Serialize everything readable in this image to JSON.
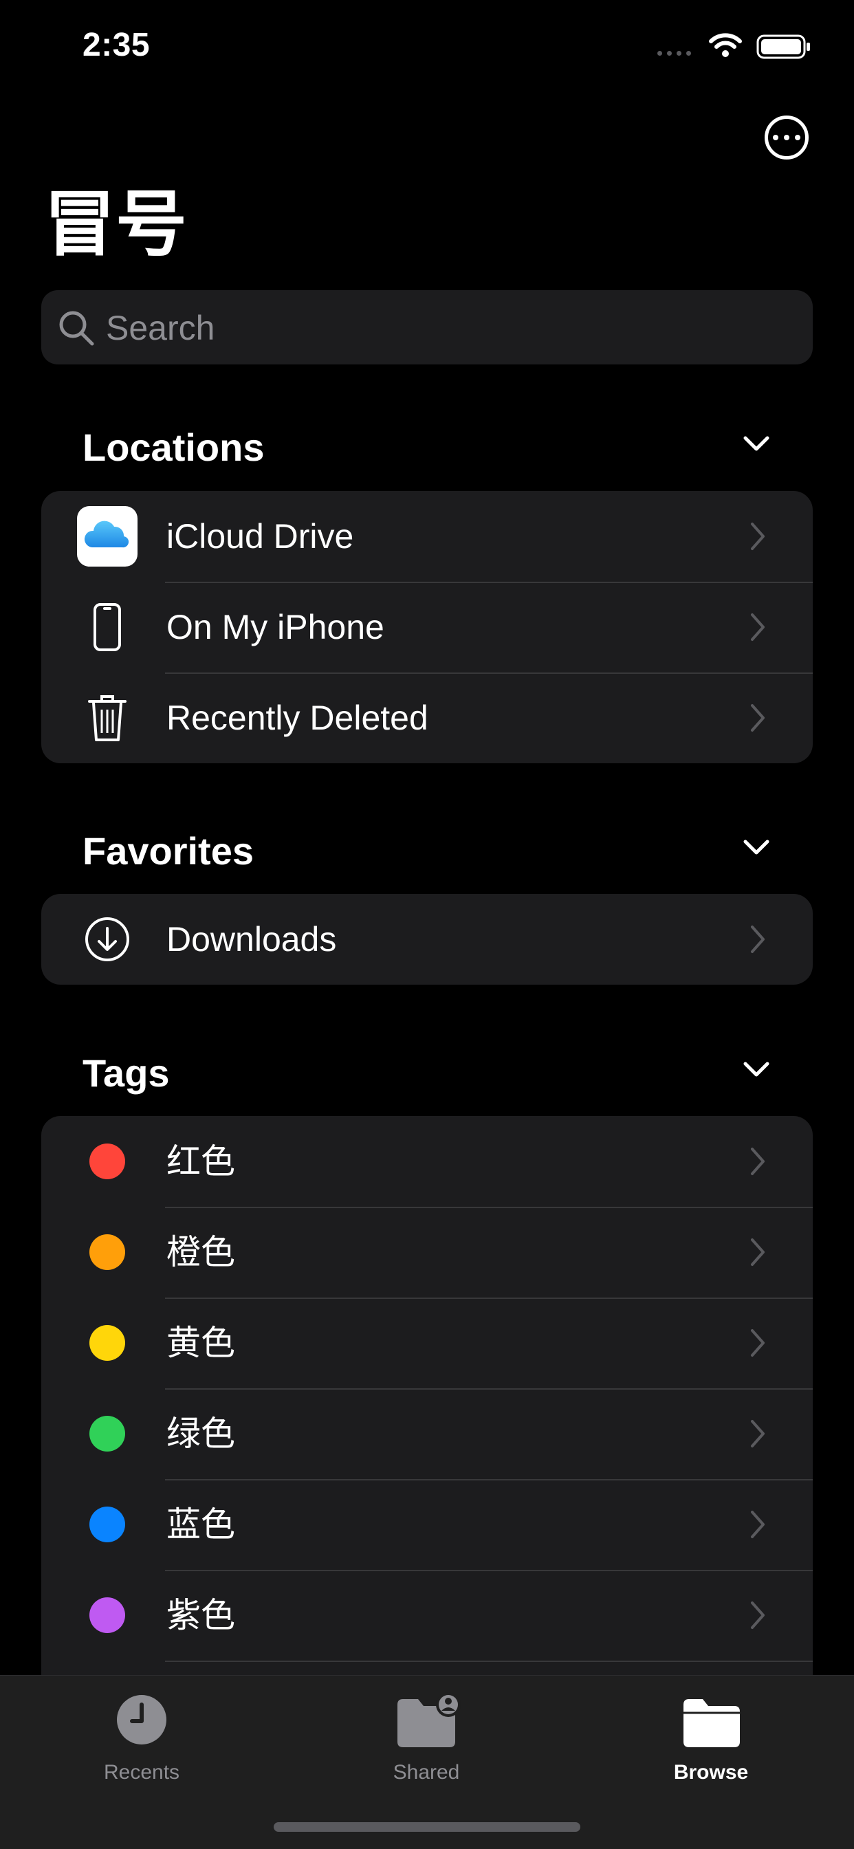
{
  "status_bar": {
    "time": "2:35"
  },
  "header": {
    "title": "冒号"
  },
  "search": {
    "placeholder": "Search"
  },
  "sections": {
    "locations": {
      "title": "Locations",
      "items": [
        {
          "label": "iCloud Drive",
          "icon": "icloud-icon"
        },
        {
          "label": "On My iPhone",
          "icon": "iphone-icon"
        },
        {
          "label": "Recently Deleted",
          "icon": "trash-icon"
        }
      ]
    },
    "favorites": {
      "title": "Favorites",
      "items": [
        {
          "label": "Downloads",
          "icon": "download-icon"
        }
      ]
    },
    "tags": {
      "title": "Tags",
      "items": [
        {
          "label": "红色",
          "color": "#ff453a"
        },
        {
          "label": "橙色",
          "color": "#ff9f0a"
        },
        {
          "label": "黄色",
          "color": "#ffd60a"
        },
        {
          "label": "绿色",
          "color": "#30d158"
        },
        {
          "label": "蓝色",
          "color": "#0a84ff"
        },
        {
          "label": "紫色",
          "color": "#bf5af2"
        }
      ]
    }
  },
  "tab_bar": {
    "tabs": [
      {
        "label": "Recents",
        "icon": "clock-icon",
        "active": false
      },
      {
        "label": "Shared",
        "icon": "shared-folder-icon",
        "active": false
      },
      {
        "label": "Browse",
        "icon": "folder-icon",
        "active": true
      }
    ]
  },
  "colors": {
    "background": "#000000",
    "card": "#1c1c1e",
    "secondary_text": "#8e8e93"
  }
}
